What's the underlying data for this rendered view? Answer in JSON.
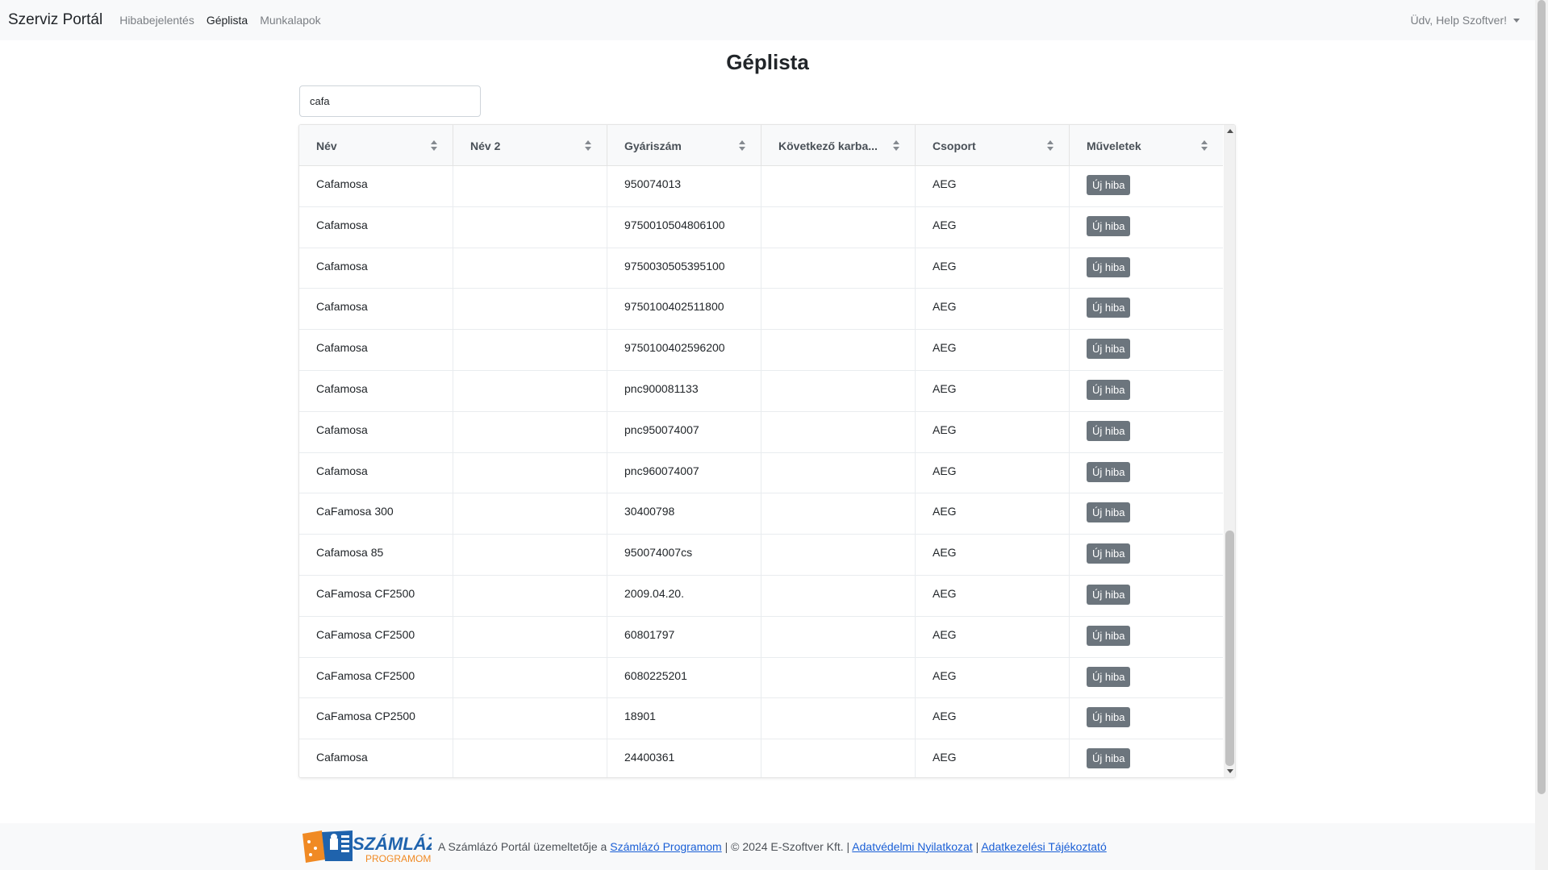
{
  "navbar": {
    "brand": "Szerviz Portál",
    "links": [
      "Hibabejelentés",
      "Géplista",
      "Munkalapok"
    ],
    "user": "Üdv, Help Szoftver!"
  },
  "page": {
    "title": "Géplista"
  },
  "search": {
    "value": "cafa"
  },
  "table": {
    "headers": [
      "Név",
      "Név 2",
      "Gyáriszám",
      "Következő karba...",
      "Csoport",
      "Műveletek"
    ],
    "button_label": "Új hiba",
    "rows": [
      {
        "nev": "Cafamosa",
        "nev2": "",
        "gyariszam": "950074013",
        "kovetkezo": "",
        "csoport": "AEG"
      },
      {
        "nev": "Cafamosa",
        "nev2": "",
        "gyariszam": "9750010504806100",
        "kovetkezo": "",
        "csoport": "AEG"
      },
      {
        "nev": "Cafamosa",
        "nev2": "",
        "gyariszam": "9750030505395100",
        "kovetkezo": "",
        "csoport": "AEG"
      },
      {
        "nev": "Cafamosa",
        "nev2": "",
        "gyariszam": "9750100402511800",
        "kovetkezo": "",
        "csoport": "AEG"
      },
      {
        "nev": "Cafamosa",
        "nev2": "",
        "gyariszam": "9750100402596200",
        "kovetkezo": "",
        "csoport": "AEG"
      },
      {
        "nev": "Cafamosa",
        "nev2": "",
        "gyariszam": "pnc900081133",
        "kovetkezo": "",
        "csoport": "AEG"
      },
      {
        "nev": "Cafamosa",
        "nev2": "",
        "gyariszam": "pnc950074007",
        "kovetkezo": "",
        "csoport": "AEG"
      },
      {
        "nev": "Cafamosa",
        "nev2": "",
        "gyariszam": "pnc960074007",
        "kovetkezo": "",
        "csoport": "AEG"
      },
      {
        "nev": "CaFamosa 300",
        "nev2": "",
        "gyariszam": "30400798",
        "kovetkezo": "",
        "csoport": "AEG"
      },
      {
        "nev": "Cafamosa 85",
        "nev2": "",
        "gyariszam": "950074007cs",
        "kovetkezo": "",
        "csoport": "AEG"
      },
      {
        "nev": "CaFamosa CF2500",
        "nev2": "",
        "gyariszam": "2009.04.20.",
        "kovetkezo": "",
        "csoport": "AEG"
      },
      {
        "nev": "CaFamosa CF2500",
        "nev2": "",
        "gyariszam": "60801797",
        "kovetkezo": "",
        "csoport": "AEG"
      },
      {
        "nev": "CaFamosa CF2500",
        "nev2": "",
        "gyariszam": "6080225201",
        "kovetkezo": "",
        "csoport": "AEG"
      },
      {
        "nev": "CaFamosa CP2500",
        "nev2": "",
        "gyariszam": "18901",
        "kovetkezo": "",
        "csoport": "AEG"
      },
      {
        "nev": "Cafamosa",
        "nev2": "",
        "gyariszam": "24400361",
        "kovetkezo": "",
        "csoport": "AEG"
      }
    ]
  },
  "footer": {
    "logo_text": "SZÁMLÁZÓ",
    "logo_sub": "PROGRAMOM",
    "text1": "A Számlázó Portál üzemeltetője a ",
    "link1": "Számlázó Programom",
    "text2": " | © 2024 E-Szoftver Kft. | ",
    "link2": "Adatvédelmi Nyilatkozat",
    "text3": " | ",
    "link3": "Adatkezelési Tájékoztató"
  },
  "colors": {
    "button": "#6c757d",
    "link": "#1a5fd6",
    "logo_blue": "#1f63ad",
    "logo_orange": "#f08a24"
  }
}
